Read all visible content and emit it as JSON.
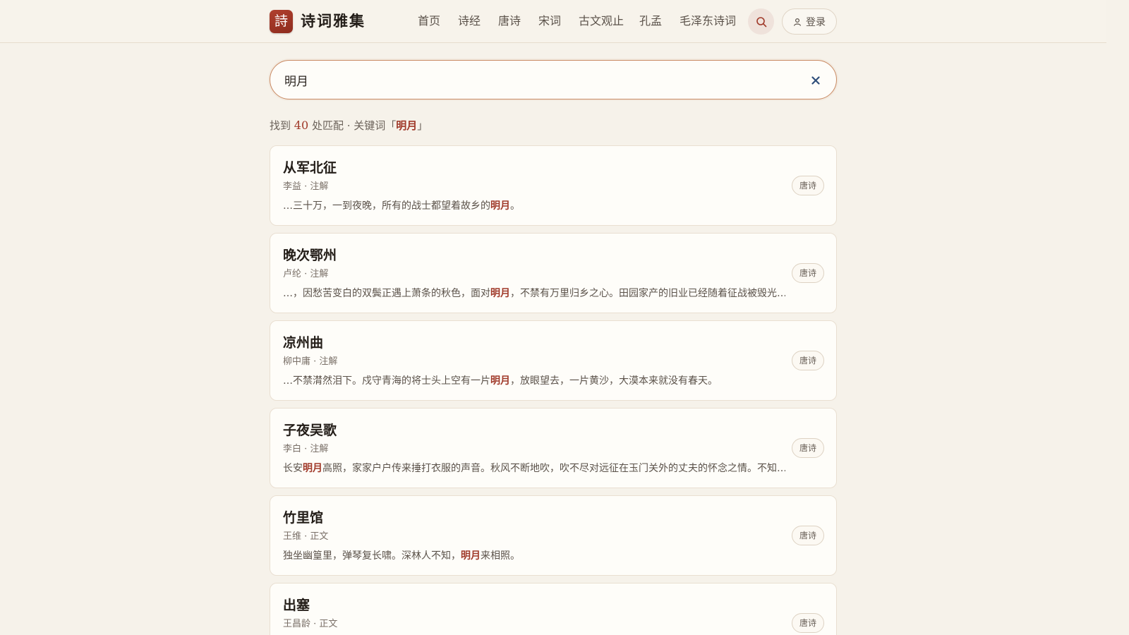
{
  "header": {
    "logo_char": "詩",
    "site_title": "诗词雅集",
    "nav": [
      "首页",
      "诗经",
      "唐诗",
      "宋词",
      "古文观止",
      "孔孟",
      "毛泽东诗词"
    ],
    "login_label": "登录"
  },
  "search": {
    "value": "明月",
    "placeholder": ""
  },
  "summary": {
    "prefix": "找到",
    "count": "40",
    "middle": "处匹配 · 关键词「",
    "keyword": "明月",
    "suffix": "」"
  },
  "results": [
    {
      "title": "从军北征",
      "meta": "李益 · 注解",
      "snippet_before": "…三十万，一到夜晚，所有的战士都望着故乡的",
      "snippet_hl": "明月",
      "snippet_after": "。",
      "tag": "唐诗"
    },
    {
      "title": "晚次鄂州",
      "meta": "卢纶 · 注解",
      "snippet_before": "…，因愁苦变白的双鬓正遇上萧条的秋色，面对",
      "snippet_hl": "明月",
      "snippet_after": "，不禁有万里归乡之心。田园家产的旧业已经随着征战被毁光…",
      "tag": "唐诗"
    },
    {
      "title": "凉州曲",
      "meta": "柳中庸 · 注解",
      "snippet_before": "…不禁潸然泪下。戍守青海的将士头上空有一片",
      "snippet_hl": "明月",
      "snippet_after": "，放眼望去，一片黄沙，大漠本来就没有春天。",
      "tag": "唐诗"
    },
    {
      "title": "子夜吴歌",
      "meta": "李白 · 注解",
      "snippet_before": "长安",
      "snippet_hl": "明月",
      "snippet_after": "高照，家家户户传来捶打衣服的声音。秋风不断地吹，吹不尽对远征在玉门关外的丈夫的怀念之情。不知…",
      "tag": "唐诗"
    },
    {
      "title": "竹里馆",
      "meta": "王维 · 正文",
      "snippet_before": "独坐幽篁里，弹琴复长啸。深林人不知，",
      "snippet_hl": "明月",
      "snippet_after": "来相照。",
      "tag": "唐诗"
    },
    {
      "title": "出塞",
      "meta": "王昌龄 · 正文",
      "snippet_before": "",
      "snippet_hl": "",
      "snippet_after": "",
      "tag": "唐诗"
    }
  ],
  "colors": {
    "accent": "#a03a2a",
    "background": "#f6f2ea",
    "card": "#fefdf9"
  },
  "icons": {
    "search": "search-icon",
    "user": "user-icon",
    "clear": "close-icon"
  }
}
